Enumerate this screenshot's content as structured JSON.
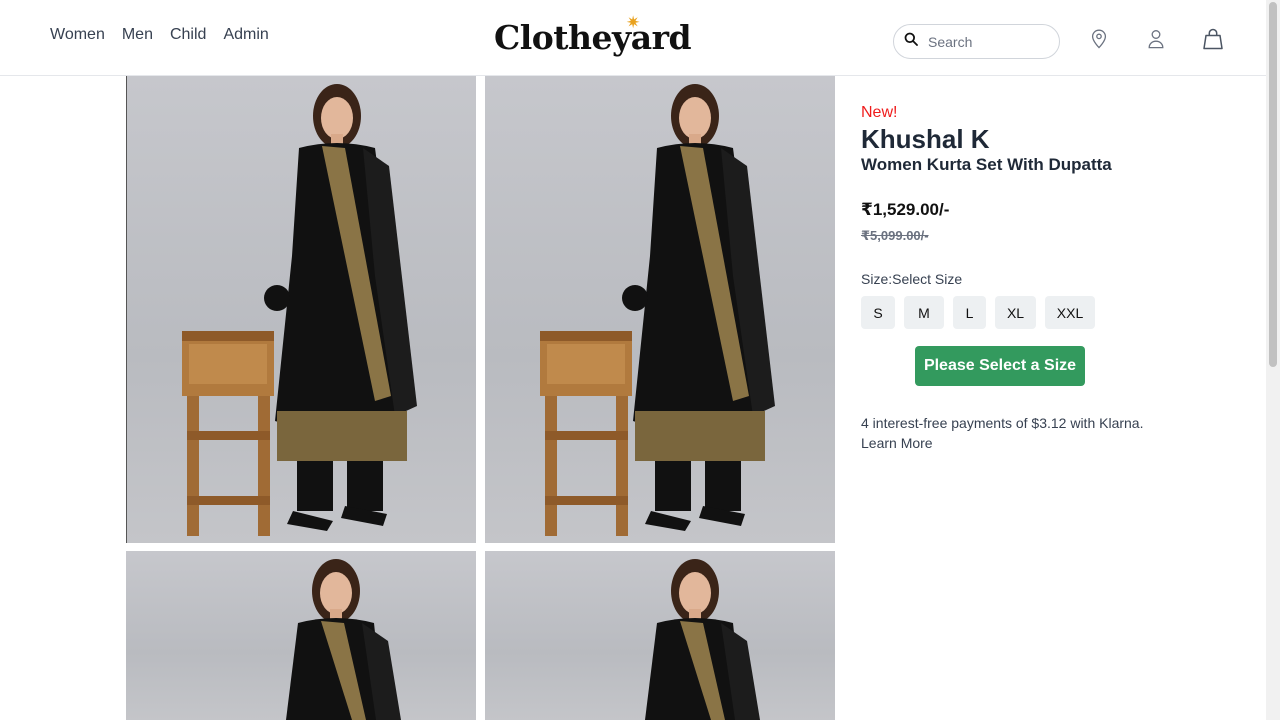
{
  "nav": {
    "links": [
      "Women",
      "Men",
      "Child",
      "Admin"
    ]
  },
  "brand_logo": {
    "text": "Clotheyard"
  },
  "search": {
    "placeholder": "Search"
  },
  "icons": {
    "search": "search-icon",
    "location": "map-pin-icon",
    "account": "user-icon",
    "cart": "shopping-bag-icon"
  },
  "gallery": {
    "image_count": 4
  },
  "product": {
    "badge": "New!",
    "brand": "Khushal K",
    "name": "Women Kurta Set With Dupatta",
    "price": "₹1,529.00/-",
    "mrp": "₹5,099.00/-",
    "size_label": "Size:Select Size",
    "sizes": [
      "S",
      "M",
      "L",
      "XL",
      "XXL"
    ],
    "cta_label": "Please Select a Size",
    "klarna_text": "4 interest-free payments of $3.12 with Klarna.",
    "learn_more": "Learn More"
  },
  "colors": {
    "accent_green": "#339a5e",
    "new_badge_red": "#ef1c1c",
    "size_button_bg": "#edf0f2",
    "logo_star": "#e9a21f"
  }
}
